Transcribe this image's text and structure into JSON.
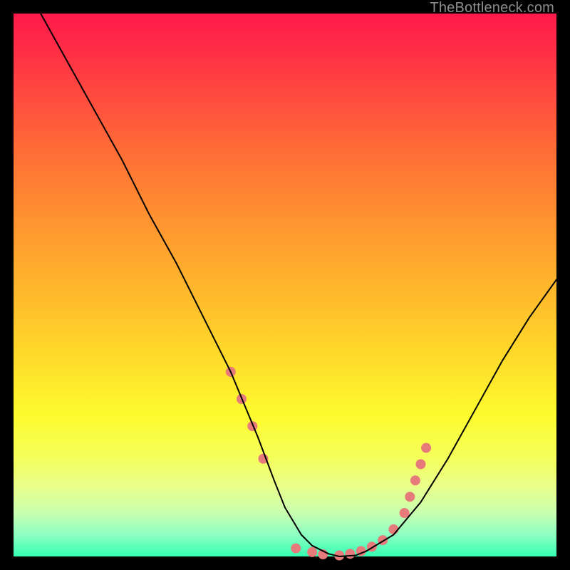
{
  "watermark": "TheBottleneck.com",
  "chart_data": {
    "type": "line",
    "title": "",
    "xlabel": "",
    "ylabel": "",
    "xlim": [
      0,
      100
    ],
    "ylim": [
      0,
      100
    ],
    "grid": false,
    "series": [
      {
        "name": "curve",
        "color": "#000000",
        "x": [
          5,
          10,
          15,
          20,
          25,
          30,
          35,
          40,
          45,
          48,
          50,
          53,
          55,
          58,
          60,
          63,
          65,
          70,
          75,
          80,
          85,
          90,
          95,
          100
        ],
        "y": [
          100,
          91,
          82,
          73,
          63,
          54,
          44,
          34,
          22,
          14,
          9,
          4,
          2,
          0.5,
          0,
          0.2,
          1,
          4,
          10,
          18,
          27,
          36,
          44,
          51
        ]
      }
    ],
    "markers": {
      "name": "dots",
      "color": "#e77a7a",
      "radius_px": 7,
      "points": [
        {
          "x": 40,
          "y": 34
        },
        {
          "x": 42,
          "y": 29
        },
        {
          "x": 44,
          "y": 24
        },
        {
          "x": 46,
          "y": 18
        },
        {
          "x": 52,
          "y": 1.5
        },
        {
          "x": 55,
          "y": 0.8
        },
        {
          "x": 57,
          "y": 0.4
        },
        {
          "x": 60,
          "y": 0.2
        },
        {
          "x": 62,
          "y": 0.5
        },
        {
          "x": 64,
          "y": 1
        },
        {
          "x": 66,
          "y": 1.8
        },
        {
          "x": 68,
          "y": 3
        },
        {
          "x": 70,
          "y": 5
        },
        {
          "x": 72,
          "y": 8
        },
        {
          "x": 73,
          "y": 11
        },
        {
          "x": 74,
          "y": 14
        },
        {
          "x": 75,
          "y": 17
        },
        {
          "x": 76,
          "y": 20
        }
      ]
    }
  }
}
